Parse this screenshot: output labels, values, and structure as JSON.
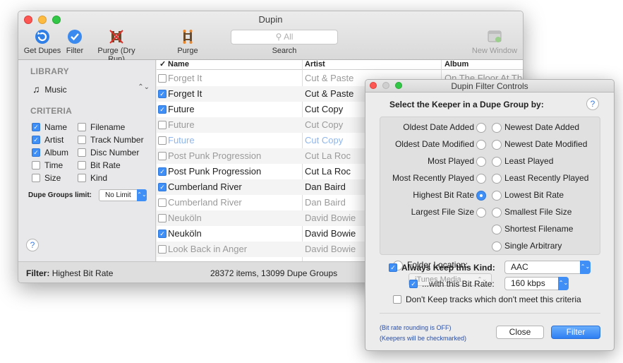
{
  "main": {
    "title": "Dupin",
    "toolbar": {
      "get_dupes": "Get Dupes",
      "filter": "Filter",
      "purge_dry": "Purge (Dry Run)",
      "purge": "Purge",
      "search_placeholder": "All",
      "search_label": "Search",
      "new_window": "New Window"
    },
    "sidebar": {
      "library_heading": "LIBRARY",
      "library_item": "Music",
      "criteria_heading": "CRITERIA",
      "criteria": [
        {
          "label": "Name",
          "checked": true
        },
        {
          "label": "Filename",
          "checked": false
        },
        {
          "label": "Artist",
          "checked": true
        },
        {
          "label": "Track Number",
          "checked": false
        },
        {
          "label": "Album",
          "checked": true
        },
        {
          "label": "Disc Number",
          "checked": false
        },
        {
          "label": "Time",
          "checked": false
        },
        {
          "label": "Bit Rate",
          "checked": false
        },
        {
          "label": "Size",
          "checked": false
        },
        {
          "label": "Kind",
          "checked": false
        }
      ],
      "dupe_groups_label": "Dupe Groups limit:",
      "dupe_groups_value": "No Limit",
      "help": "?"
    },
    "table": {
      "headers": {
        "check": "✓",
        "name": "Name",
        "artist": "Artist",
        "album": "Album"
      },
      "rows": [
        {
          "checked": false,
          "name": "Forget It",
          "artist": "Cut & Paste",
          "album": "On The Floor At The",
          "style": "dim"
        },
        {
          "checked": true,
          "name": "Forget It",
          "artist": "Cut & Paste",
          "album": "",
          "style": "normal"
        },
        {
          "checked": true,
          "name": "Future",
          "artist": "Cut Copy",
          "album": "",
          "style": "normal"
        },
        {
          "checked": false,
          "name": "Future",
          "artist": "Cut Copy",
          "album": "",
          "style": "dim"
        },
        {
          "checked": false,
          "name": "Future",
          "artist": "Cut Copy",
          "album": "",
          "style": "blue"
        },
        {
          "checked": false,
          "name": "Post Punk Progression",
          "artist": "Cut La Roc",
          "album": "",
          "style": "dim"
        },
        {
          "checked": true,
          "name": "Post Punk Progression",
          "artist": "Cut La Roc",
          "album": "",
          "style": "normal"
        },
        {
          "checked": true,
          "name": "Cumberland River",
          "artist": "Dan Baird",
          "album": "",
          "style": "normal"
        },
        {
          "checked": false,
          "name": "Cumberland River",
          "artist": "Dan Baird",
          "album": "",
          "style": "dim"
        },
        {
          "checked": false,
          "name": "Neuköln",
          "artist": "David Bowie",
          "album": "",
          "style": "dim"
        },
        {
          "checked": true,
          "name": "Neuköln",
          "artist": "David Bowie",
          "album": "",
          "style": "normal"
        },
        {
          "checked": false,
          "name": "Look Back in Anger",
          "artist": "David Bowie",
          "album": "",
          "style": "dim"
        }
      ]
    },
    "status": {
      "filter_label": "Filter:",
      "filter_value": "Highest Bit Rate",
      "counts": "28372 items, 13099 Dupe Groups"
    }
  },
  "dialog": {
    "title": "Dupin Filter Controls",
    "heading": "Select the Keeper in a Dupe Group by:",
    "help": "?",
    "left_options": [
      {
        "label": "Oldest Date Added",
        "selected": false
      },
      {
        "label": "Oldest Date Modified",
        "selected": false
      },
      {
        "label": "Most Played",
        "selected": false
      },
      {
        "label": "Most Recently Played",
        "selected": false
      },
      {
        "label": "Highest Bit Rate",
        "selected": true
      },
      {
        "label": "Largest File Size",
        "selected": false
      }
    ],
    "folder_label": "Folder Location:",
    "folder_value": "iTunes Media",
    "right_options": [
      {
        "label": "Newest Date Added",
        "selected": false
      },
      {
        "label": "Newest Date Modified",
        "selected": false
      },
      {
        "label": "Least Played",
        "selected": false
      },
      {
        "label": "Least Recently Played",
        "selected": false
      },
      {
        "label": "Lowest Bit Rate",
        "selected": false
      },
      {
        "label": "Smallest File Size",
        "selected": false
      },
      {
        "label": "Shortest Filename",
        "selected": false
      },
      {
        "label": "Single Arbitrary",
        "selected": false
      }
    ],
    "always_keep_label": "Always Keep this Kind:",
    "always_keep_checked": true,
    "kind_value": "AAC",
    "bitrate_label": "...with this Bit Rate:",
    "bitrate_checked": true,
    "bitrate_value": "160 kbps",
    "dont_keep_label": "Don't Keep tracks which don't meet this criteria",
    "dont_keep_checked": false,
    "note1": "(Bit rate rounding is OFF)",
    "note2": "(Keepers will be checkmarked)",
    "close_label": "Close",
    "filter_label": "Filter"
  }
}
